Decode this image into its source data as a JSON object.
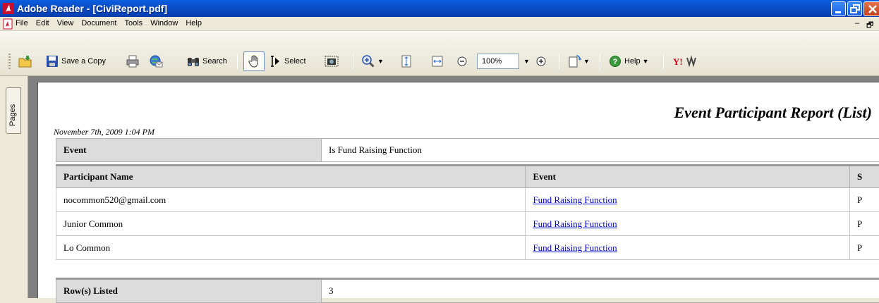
{
  "window": {
    "title": "Adobe Reader - [CiviReport.pdf]"
  },
  "menu": {
    "items": [
      "File",
      "Edit",
      "View",
      "Document",
      "Tools",
      "Window",
      "Help"
    ]
  },
  "toolbar": {
    "save_copy": "Save a Copy",
    "search": "Search",
    "select": "Select",
    "zoom": "100%",
    "help": "Help"
  },
  "left_panel": {
    "pages_tab": "Pages"
  },
  "report": {
    "title": "Event Participant Report (List)",
    "date": "November 7th, 2009 1:04 PM",
    "filter": {
      "label": "Event",
      "value": "Is Fund Raising Function"
    },
    "columns": [
      "Participant Name",
      "Event",
      "S"
    ],
    "rows": [
      {
        "name": "nocommon520@gmail.com",
        "event": "Fund Raising Function ",
        "status": "P"
      },
      {
        "name": "Junior Common",
        "event": "Fund Raising Function ",
        "status": "P"
      },
      {
        "name": "Lo Common",
        "event": "Fund Raising Function ",
        "status": "P"
      }
    ],
    "summary": {
      "label": "Row(s) Listed",
      "value": "3"
    }
  },
  "colors": {
    "title_bar": "#0a4fc8",
    "header_cell": "#dcdcdc",
    "link": "#0000cc"
  }
}
